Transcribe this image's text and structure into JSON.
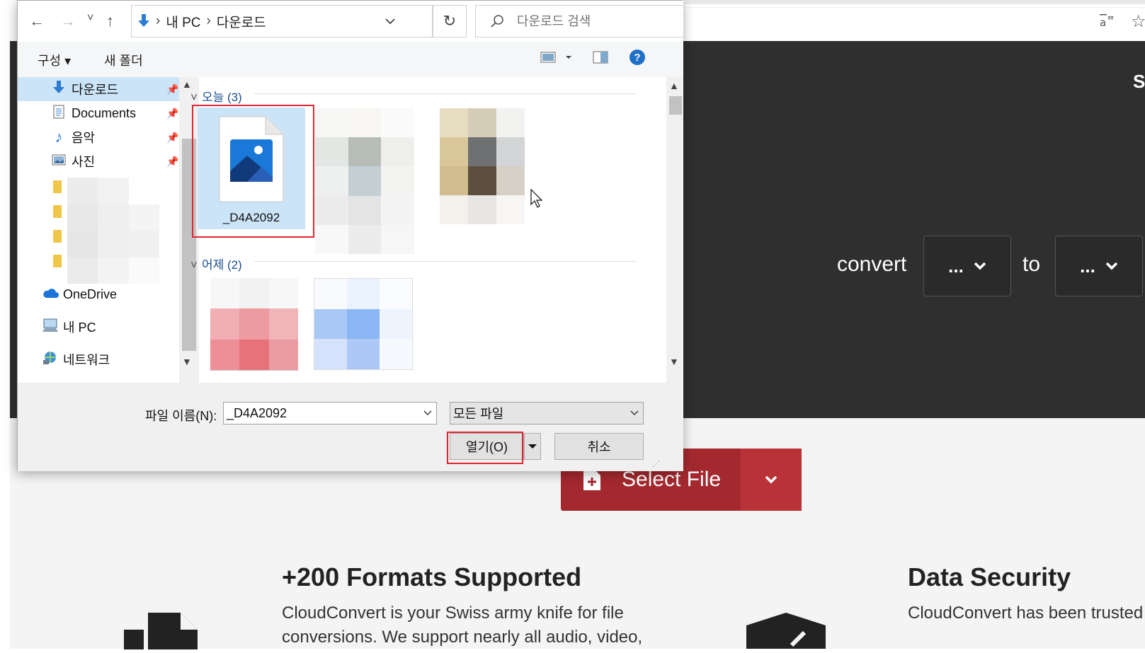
{
  "dialog": {
    "nav": {
      "back": "←",
      "forward": "→",
      "recent": "˅",
      "up": "↑",
      "path": [
        "내 PC",
        "다운로드"
      ],
      "refresh": "↻",
      "search_placeholder": "다운로드 검색"
    },
    "toolbar": {
      "organize": "구성 ▾",
      "new_folder": "새 폴더",
      "help": "?"
    },
    "nav_pane": {
      "items": [
        {
          "label": "다운로드",
          "icon": "download-arrow-icon",
          "pinned": true
        },
        {
          "label": "Documents",
          "icon": "document-icon",
          "pinned": true
        },
        {
          "label": "음악",
          "icon": "music-icon",
          "pinned": true
        },
        {
          "label": "사진",
          "icon": "pictures-icon",
          "pinned": true
        },
        {
          "label": "OneDrive",
          "icon": "cloud-icon"
        },
        {
          "label": "내 PC",
          "icon": "computer-icon"
        },
        {
          "label": "네트워크",
          "icon": "network-icon"
        }
      ]
    },
    "files": {
      "groups": [
        {
          "header": "오늘 (3)"
        },
        {
          "header": "어제 (2)"
        }
      ],
      "selected_file": "_D4A2092"
    },
    "bottom": {
      "filename_label": "파일 이름(N):",
      "filename_value": "_D4A2092",
      "filetype_value": "모든 파일",
      "open_button": "열기(O)",
      "cancel_button": "취소"
    }
  },
  "webpage": {
    "hero_corner": "S",
    "convert": "convert",
    "to": "to",
    "from_select": "...",
    "to_select": "...",
    "select_file": "Select File",
    "features": [
      {
        "title": "+200 Formats Supported",
        "text": "CloudConvert is your Swiss army knife for file conversions. We support nearly all audio, video,"
      },
      {
        "title": "Data Security",
        "text": "CloudConvert has been trusted by our customers since its founding in"
      }
    ]
  },
  "colors": {
    "hero_bg": "#2f2f2f",
    "accent_red": "#a4292f",
    "selection_blue": "#cce4f7",
    "highlight_red": "#e0262f",
    "link_blue": "#1a4d8f"
  }
}
